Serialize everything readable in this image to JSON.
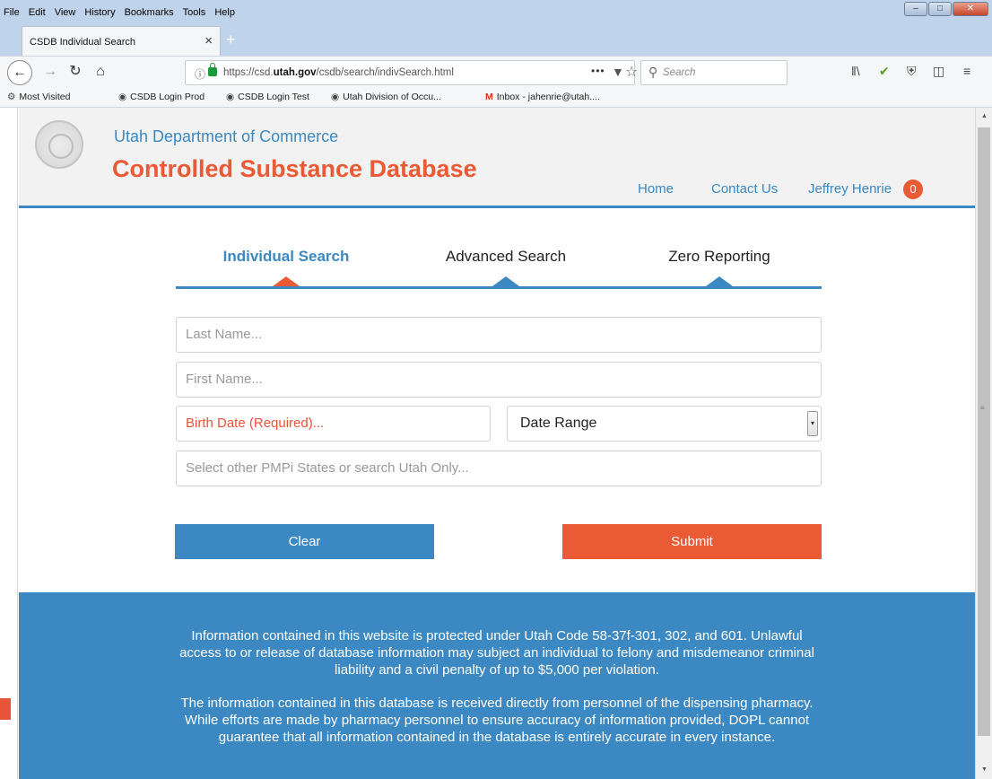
{
  "browser": {
    "menu": [
      "File",
      "Edit",
      "View",
      "History",
      "Bookmarks",
      "Tools",
      "Help"
    ],
    "tab_title": "CSDB Individual Search",
    "url_host": "https://csd.",
    "url_domain": "utah.gov",
    "url_path": "/csdb/search/indivSearch.html",
    "search_placeholder": "Search",
    "bookmarks": [
      {
        "label": "Most Visited",
        "icon": "gear-icon"
      },
      {
        "label": "CSDB Login Prod",
        "icon": "globe-icon"
      },
      {
        "label": "CSDB Login Test",
        "icon": "globe-icon"
      },
      {
        "label": "Utah Division of Occu...",
        "icon": "globe-icon"
      },
      {
        "label": "Inbox - jahenrie@utah....",
        "icon": "gmail-icon"
      }
    ]
  },
  "header": {
    "department": "Utah Department of Commerce",
    "brand": "Controlled Substance Database",
    "nav": [
      "Home",
      "Contact Us",
      "Jeffrey Henrie"
    ],
    "badge_count": "0"
  },
  "tabs": [
    {
      "label": "Individual Search",
      "active": true
    },
    {
      "label": "Advanced Search",
      "active": false
    },
    {
      "label": "Zero Reporting",
      "active": false
    }
  ],
  "form": {
    "last_name_placeholder": "Last Name...",
    "first_name_placeholder": "First Name...",
    "birth_date_placeholder": "Birth Date (Required)...",
    "date_range_value": "Date Range",
    "states_placeholder": "Select other PMPi States or search Utah Only...",
    "clear_label": "Clear",
    "submit_label": "Submit"
  },
  "footer": {
    "notice_1": "Information contained in this website is protected under Utah Code 58-37f-301, 302, and 601. Unlawful access to or release of database information may subject an individual to felony and misdemeanor criminal liability and a civil penalty of up to $5,000 per violation.",
    "notice_2": "The information contained in this database is received directly from personnel of the dispensing pharmacy. While efforts are made by pharmacy personnel to ensure accuracy of information provided, DOPL cannot guarantee that all information contained in the database is entirely accurate in every instance."
  },
  "colors": {
    "accent_blue": "#3b88c3",
    "accent_orange": "#ea5a35"
  }
}
